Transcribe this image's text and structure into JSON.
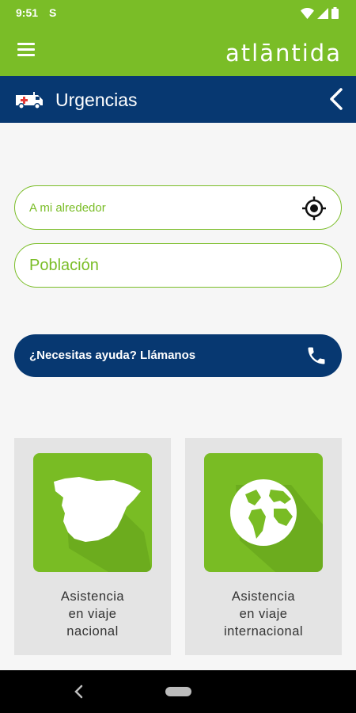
{
  "status_bar": {
    "time": "9:51",
    "app_indicator": "S",
    "icons": [
      "wifi-icon",
      "signal-icon",
      "battery-icon"
    ]
  },
  "app_bar": {
    "brand": "atlāntida",
    "menu_icon": "hamburger-icon"
  },
  "section": {
    "title": "Urgencias",
    "icon": "ambulance-icon",
    "back_icon": "chevron-left-icon"
  },
  "search": {
    "nearby_placeholder": "A mi alrededor",
    "nearby_icon": "location-target-icon",
    "town_placeholder": "Población"
  },
  "help": {
    "label": "¿Necesitas ayuda? Llámanos",
    "icon": "phone-icon"
  },
  "cards": [
    {
      "line1": "Asistencia",
      "line2": "en viaje",
      "line3": "nacional",
      "icon": "spain-map-icon"
    },
    {
      "line1": "Asistencia",
      "line2": "en viaje",
      "line3": "internacional",
      "icon": "globe-icon"
    }
  ],
  "colors": {
    "green": "#7abd27",
    "navy": "#073871",
    "card_bg": "#e4e4e4",
    "background": "#f6f6f6"
  }
}
